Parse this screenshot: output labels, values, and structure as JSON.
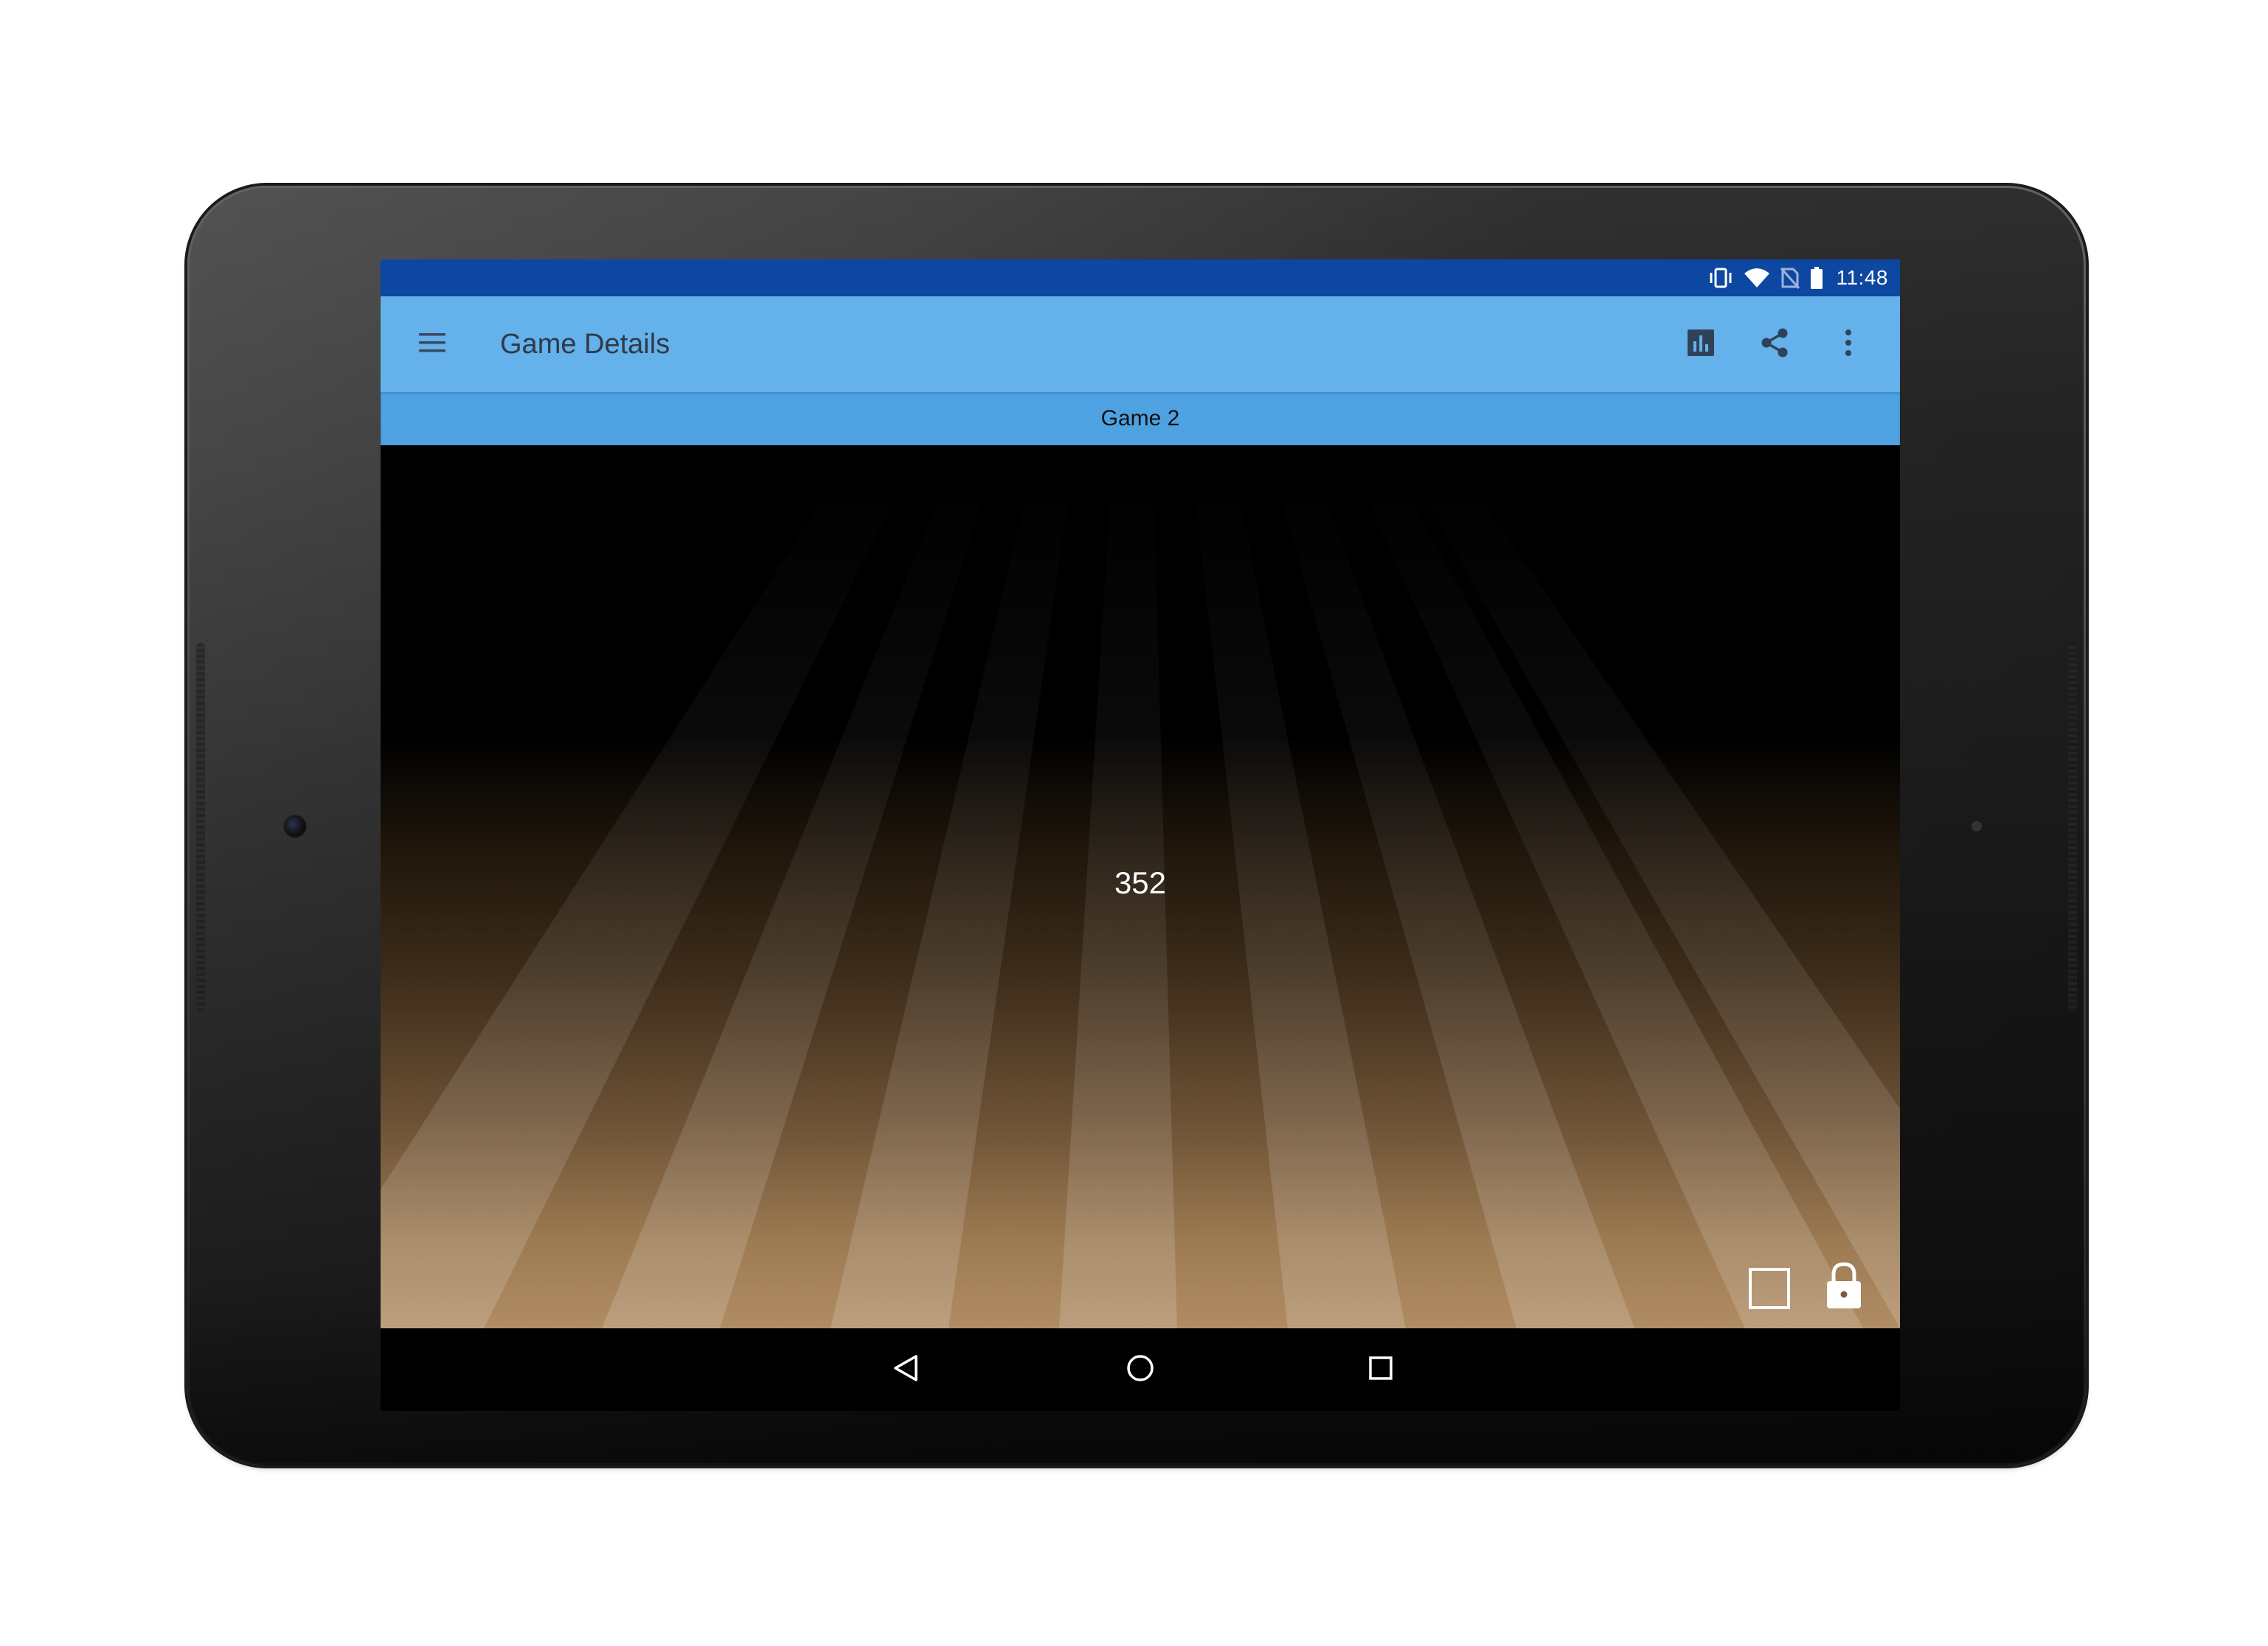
{
  "status_bar": {
    "time": "11:48",
    "icons": [
      "vibrate-icon",
      "wifi-icon",
      "no-sim-icon",
      "battery-icon"
    ],
    "color": "#0d47a1"
  },
  "app_bar": {
    "title": "Game Details",
    "menu_icon": "hamburger-menu-icon",
    "actions": [
      "bar-chart-icon",
      "share-icon",
      "more-vert-icon"
    ],
    "color": "#64b1eb"
  },
  "sub_bar": {
    "title": "Game 2",
    "color": "#4ea2e2"
  },
  "game": {
    "score": "352",
    "controls": [
      "square-outline-icon",
      "lock-icon"
    ]
  },
  "nav_bar": {
    "buttons": [
      "back-triangle-icon",
      "home-circle-icon",
      "recents-square-icon"
    ]
  }
}
